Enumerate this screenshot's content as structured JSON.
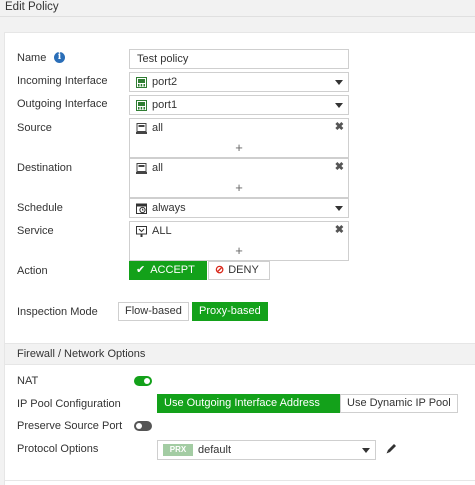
{
  "header": {
    "title": "Edit Policy"
  },
  "form": {
    "name": {
      "label": "Name",
      "value": "Test policy"
    },
    "incoming": {
      "label": "Incoming Interface",
      "value": "port2",
      "icon": "interface-port-icon"
    },
    "outgoing": {
      "label": "Outgoing Interface",
      "value": "port1",
      "icon": "interface-port-icon"
    },
    "source": {
      "label": "Source",
      "value": "all",
      "add": "+",
      "remove": "✖"
    },
    "destination": {
      "label": "Destination",
      "value": "all",
      "add": "+",
      "remove": "✖"
    },
    "schedule": {
      "label": "Schedule",
      "value": "always"
    },
    "service": {
      "label": "Service",
      "value": "ALL",
      "add": "+",
      "remove": "✖"
    },
    "action": {
      "label": "Action",
      "accept": "ACCEPT",
      "deny": "DENY",
      "accept_check": "✔",
      "deny_symbol": "⊘"
    },
    "inspection": {
      "label": "Inspection Mode",
      "options": [
        "Flow-based",
        "Proxy-based"
      ],
      "selected": "Proxy-based"
    }
  },
  "firewall": {
    "section_title": "Firewall / Network Options",
    "nat": {
      "label": "NAT",
      "enabled": true
    },
    "ip_pool": {
      "label": "IP Pool Configuration",
      "options": [
        "Use Outgoing Interface Address",
        "Use Dynamic IP Pool"
      ],
      "selected": "Use Outgoing Interface Address"
    },
    "preserve_port": {
      "label": "Preserve Source Port",
      "enabled": false
    },
    "protocol": {
      "label": "Protocol Options",
      "badge": "PRX",
      "value": "default"
    }
  },
  "colors": {
    "accent": "#13a11a",
    "deny": "#d9291c",
    "info": "#2a6eb8"
  }
}
